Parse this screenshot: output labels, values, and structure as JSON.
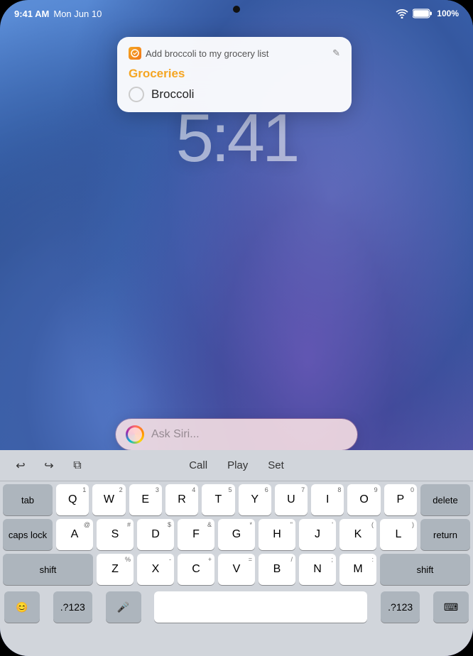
{
  "status_bar": {
    "time": "9:41 AM",
    "date": "Mon Jun 10",
    "battery": "100%",
    "wifi_icon": "wifi-icon",
    "battery_icon": "battery-icon"
  },
  "lock_clock": "5:41",
  "notification": {
    "subtitle": "Add broccoli to my grocery list",
    "edit_icon": "✎",
    "list_name": "Groceries",
    "item_name": "Broccoli"
  },
  "siri": {
    "placeholder": "Ask Siri..."
  },
  "keyboard": {
    "toolbar": {
      "undo_label": "↩",
      "redo_label": "↪",
      "copy_label": "⧉",
      "call_label": "Call",
      "play_label": "Play",
      "set_label": "Set"
    },
    "rows": [
      [
        "Q",
        "W",
        "E",
        "R",
        "T",
        "Y",
        "U",
        "I",
        "O",
        "P"
      ],
      [
        "A",
        "S",
        "D",
        "F",
        "G",
        "H",
        "J",
        "K",
        "L"
      ],
      [
        "Z",
        "X",
        "C",
        "V",
        "B",
        "N",
        "M"
      ]
    ],
    "special_keys": {
      "tab": "tab",
      "delete": "delete",
      "caps_lock": "caps lock",
      "return": "return",
      "shift_left": "shift",
      "shift_right": "shift",
      "emoji": "😊",
      "num_left": ".?123",
      "mic": "🎤",
      "space": " ",
      "num_right": ".?123",
      "keyboard_icon": "⌨"
    },
    "sub_labels": {
      "Q": "1",
      "W": "2",
      "E": "3",
      "R": "4",
      "T": "5",
      "Y": "6",
      "U": "7",
      "I": "8",
      "O": "9",
      "P": "0",
      "A": "@",
      "S": "#",
      "D": "$",
      "F": "&",
      "G": "*",
      "H": "\"",
      "J": "'",
      "K": "(",
      "L": ")",
      "Z": "%",
      "X": "-",
      "C": "+",
      "V": "=",
      "B": "/",
      "N": ";",
      "M": ":"
    }
  }
}
